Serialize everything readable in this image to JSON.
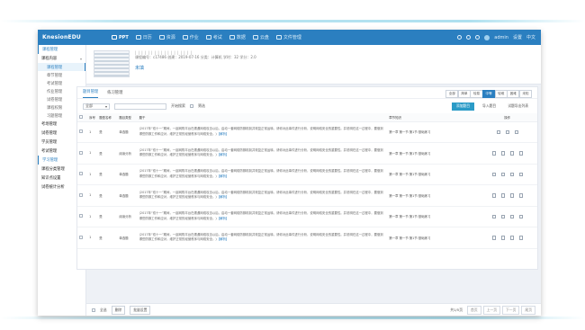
{
  "topbar": {
    "brand": "KnesionEDU",
    "nav": [
      {
        "icon": "grid-icon",
        "label": "PPT",
        "active": true
      },
      {
        "icon": "book-icon",
        "label": "日历"
      },
      {
        "icon": "star-icon",
        "label": "资源"
      },
      {
        "icon": "chat-icon",
        "label": "作业"
      },
      {
        "icon": "user-icon",
        "label": "考试"
      },
      {
        "icon": "chart-icon",
        "label": "数据"
      },
      {
        "icon": "cloud-icon",
        "label": "云盘"
      },
      {
        "icon": "folder-icon",
        "label": "文件管理"
      }
    ],
    "user": "admin",
    "right_labels": [
      "设置",
      "中文"
    ]
  },
  "sidebar": {
    "items": [
      {
        "label": "课程管理",
        "type": "head"
      },
      {
        "label": "课程内容",
        "type": "group",
        "arrow": "▾"
      },
      {
        "label": "课程管理",
        "type": "sub",
        "active": true
      },
      {
        "label": "章节管理",
        "type": "sub"
      },
      {
        "label": "考试管理",
        "type": "sub"
      },
      {
        "label": "作业管理",
        "type": "sub"
      },
      {
        "label": "试卷管理",
        "type": "sub"
      },
      {
        "label": "课程权限",
        "type": "sub"
      },
      {
        "label": "习题管理",
        "type": "sub"
      },
      {
        "label": "考场管理",
        "type": "group",
        "arrow": "›"
      },
      {
        "label": "试卷管理",
        "type": "group",
        "arrow": "›"
      },
      {
        "label": "学员管理",
        "type": "group",
        "arrow": "›"
      },
      {
        "label": "考试管理",
        "type": "group",
        "arrow": "›"
      },
      {
        "label": "学习管理",
        "type": "head"
      },
      {
        "label": "课程分类管理",
        "type": "group",
        "arrow": "›"
      },
      {
        "label": "知识点设置",
        "type": "group",
        "arrow": "›"
      },
      {
        "label": "试卷统计分析",
        "type": "group",
        "arrow": "›"
      }
    ]
  },
  "course": {
    "code_line": "| | | | | | | | | | | | | | | | | |",
    "info": "课程编号：c17486    创建：2019-07-16    分类：计算机    学时：32    学分：2.0",
    "title": "未填"
  },
  "panel": {
    "tabs": [
      "题目管理",
      "练习管理"
    ],
    "difficulty": [
      "全部",
      "简单",
      "较易",
      "中等",
      "较难",
      "困难",
      "未知"
    ],
    "difficulty_active": 3,
    "filters": {
      "select_value": "全部",
      "search_placeholder": "",
      "search_label": "开始搜索",
      "checkbox_label": "筛选"
    },
    "actions": {
      "add": "添加题目",
      "import": "导入题目",
      "export": "试题导出列表"
    },
    "columns": [
      "",
      "序号",
      "题型名称",
      "题目类型",
      "题干",
      "章节知识",
      "操作"
    ],
    "rows": [
      {
        "no": "1",
        "name": "是",
        "type": "单选题",
        "text": "(2017年“双十一”期间，一起网购平台在遭遇网络攻击以后，启动一套网络防御机制并恢复正常运转。请你对此事件进行分析，说明网络安全的重要性。并说明在这一过程中，要做到哪些防御工作和应对，维护正常的经营秩序与网络安全。)",
        "ans": "【解析】",
        "chapter": "第一章 第一节 第1节 基础练习",
        "ops": 3
      },
      {
        "no": "1",
        "name": "是",
        "type": "阅读分析",
        "text": "(2017年“双十一”期间，一起网购平台在遭遇网络攻击以后，启动一套网络防御机制并恢复正常运转。请你对此事件进行分析，说明网络安全的重要性。并说明在这一过程中，要做到哪些防御工作和应对，维护正常的经营秩序与网络安全。)",
        "ans": "【解析】",
        "chapter": "第一章 第一节 第1节 基础练习",
        "ops": 4
      },
      {
        "no": "1",
        "name": "是",
        "type": "单选题",
        "text": "(2017年“双十一”期间，一起网购平台在遭遇网络攻击以后，启动一套网络防御机制并恢复正常运转。请你对此事件进行分析，说明网络安全的重要性。并说明在这一过程中，要做到哪些防御工作和应对，维护正常的经营秩序与网络安全。)",
        "ans": "【解析】",
        "chapter": "第一章 第一节 第1节 基础练习",
        "ops": 4
      },
      {
        "no": "1",
        "name": "是",
        "type": "单选题",
        "text": "(2017年“双十一”期间，一起网购平台在遭遇网络攻击以后，启动一套网络防御机制并恢复正常运转。请你对此事件进行分析，说明网络安全的重要性。并说明在这一过程中，要做到哪些防御工作和应对，维护正常的经营秩序与网络安全。)",
        "ans": "【解析】",
        "chapter": "第一章 第一节 第1节 基础练习",
        "ops": 4
      },
      {
        "no": "1",
        "name": "是",
        "type": "阅读分析",
        "text": "(2017年“双十一”期间，一起网购平台在遭遇网络攻击以后，启动一套网络防御机制并恢复正常运转。请你对此事件进行分析，说明网络安全的重要性。并说明在这一过程中，要做到哪些防御工作和应对，维护正常的经营秩序与网络安全。)",
        "ans": "【解析】",
        "chapter": "第一章 第一节 第1节 基础练习",
        "ops": 4
      },
      {
        "no": "1",
        "name": "是",
        "type": "单选题",
        "text": "(2017年“双十一”期间，一起网购平台在遭遇网络攻击以后，启动一套网络防御机制并恢复正常运转。请你对此事件进行分析，说明网络安全的重要性。并说明在这一过程中，要做到哪些防御工作和应对，维护正常的经营秩序与网络安全。)",
        "ans": "【解析】",
        "chapter": "第一章 第一节 第1节 基础练习",
        "ops": 4
      }
    ]
  },
  "footer": {
    "select_all": "全选",
    "delete": "删除",
    "batch": "批量设置",
    "page_info": "共1/5页",
    "pages": [
      "首页",
      "上一页",
      "下一页",
      "尾页"
    ]
  },
  "colors": {
    "primary": "#2b7fc0",
    "accent": "#2b9bc7",
    "topbar": "#2b7fc0"
  }
}
